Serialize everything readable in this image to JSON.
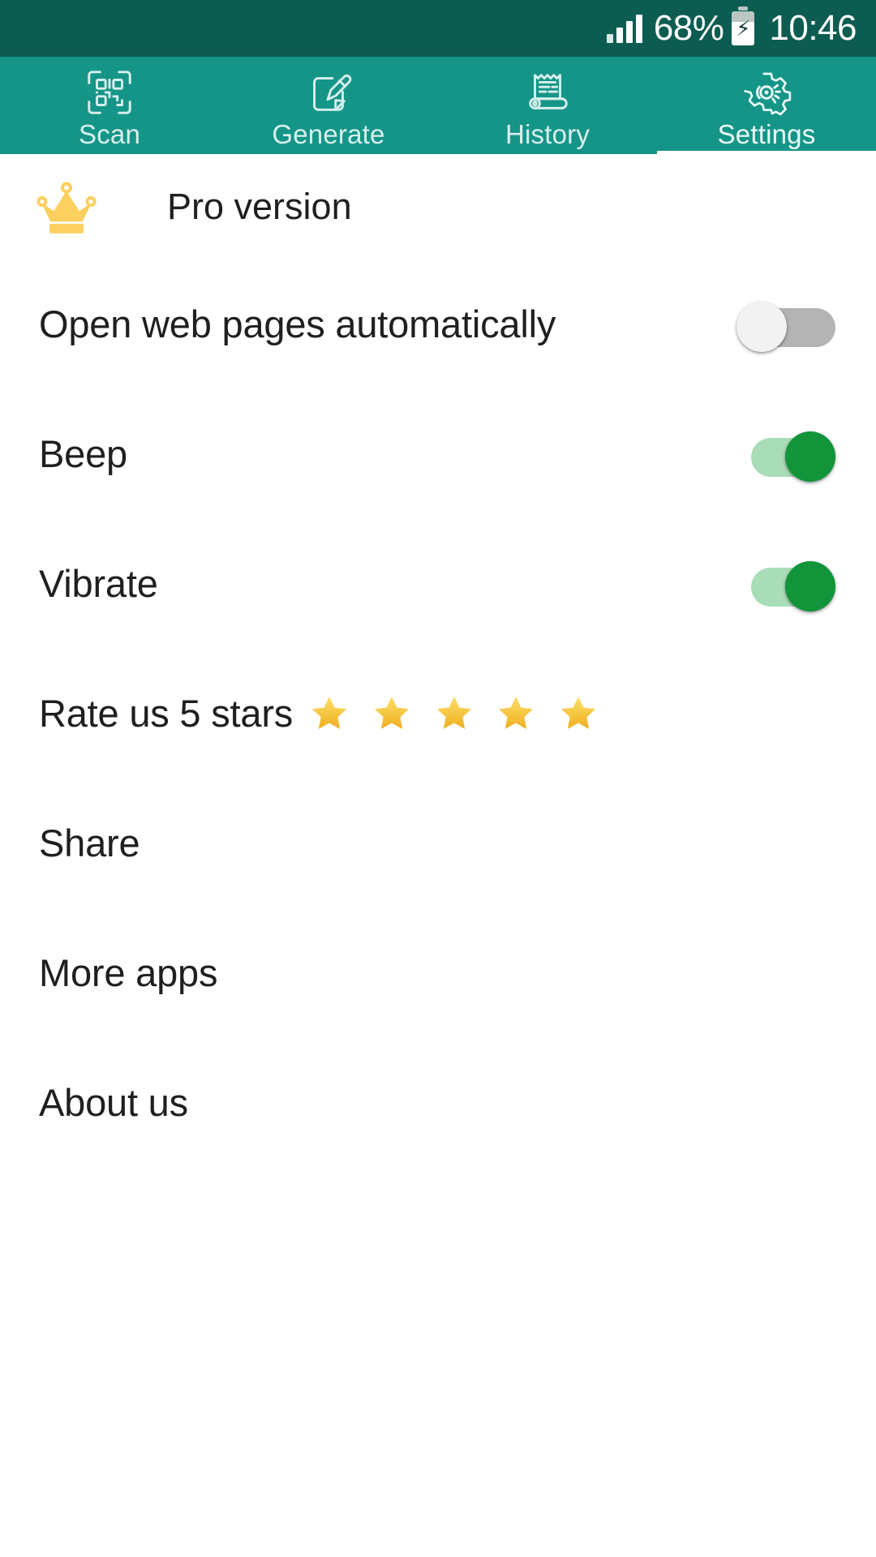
{
  "status_bar": {
    "signal_icon": "signal-bars-icon",
    "battery_percent": "68%",
    "battery_icon": "battery-charging-icon",
    "charging_glyph": "⚡",
    "time": "10:46",
    "background_color": "#0d5c51"
  },
  "tabs": {
    "active_index": 3,
    "background_color": "#159588",
    "items": [
      {
        "label": "Scan",
        "icon": "qr-scan-icon",
        "active": false
      },
      {
        "label": "Generate",
        "icon": "edit-square-icon",
        "active": false
      },
      {
        "label": "History",
        "icon": "receipt-scroll-icon",
        "active": false
      },
      {
        "label": "Settings",
        "icon": "gear-icon",
        "active": true
      }
    ]
  },
  "settings": {
    "pro": {
      "label": "Pro version",
      "icon": "crown-icon",
      "icon_color": "#fbd05e"
    },
    "rows": [
      {
        "label": "Open web pages automatically",
        "type": "toggle",
        "value": false,
        "name": "open-web-pages-automatically"
      },
      {
        "label": "Beep",
        "type": "toggle",
        "value": true,
        "name": "beep"
      },
      {
        "label": "Vibrate",
        "type": "toggle",
        "value": true,
        "name": "vibrate"
      },
      {
        "label": "Rate us 5 stars",
        "type": "link",
        "stars": "⭐⭐⭐⭐⭐",
        "star_count": 5,
        "name": "rate-us"
      },
      {
        "label": "Share",
        "type": "link",
        "name": "share"
      },
      {
        "label": "More apps",
        "type": "link",
        "name": "more-apps"
      },
      {
        "label": "About us",
        "type": "link",
        "name": "about-us"
      }
    ]
  },
  "colors": {
    "status_bar": "#0d5c51",
    "tab_bar": "#159588",
    "tab_label": "#d7efec",
    "content_background": "#ffffff",
    "text_primary": "#1f1f1f",
    "toggle_on_knob": "#12953a",
    "toggle_on_track": "#a9ddb8",
    "toggle_off_knob": "#f2f2f2",
    "toggle_off_track": "#b4b4b4",
    "crown_gold": "#fbd05e",
    "star_gold": "#f5c343"
  }
}
